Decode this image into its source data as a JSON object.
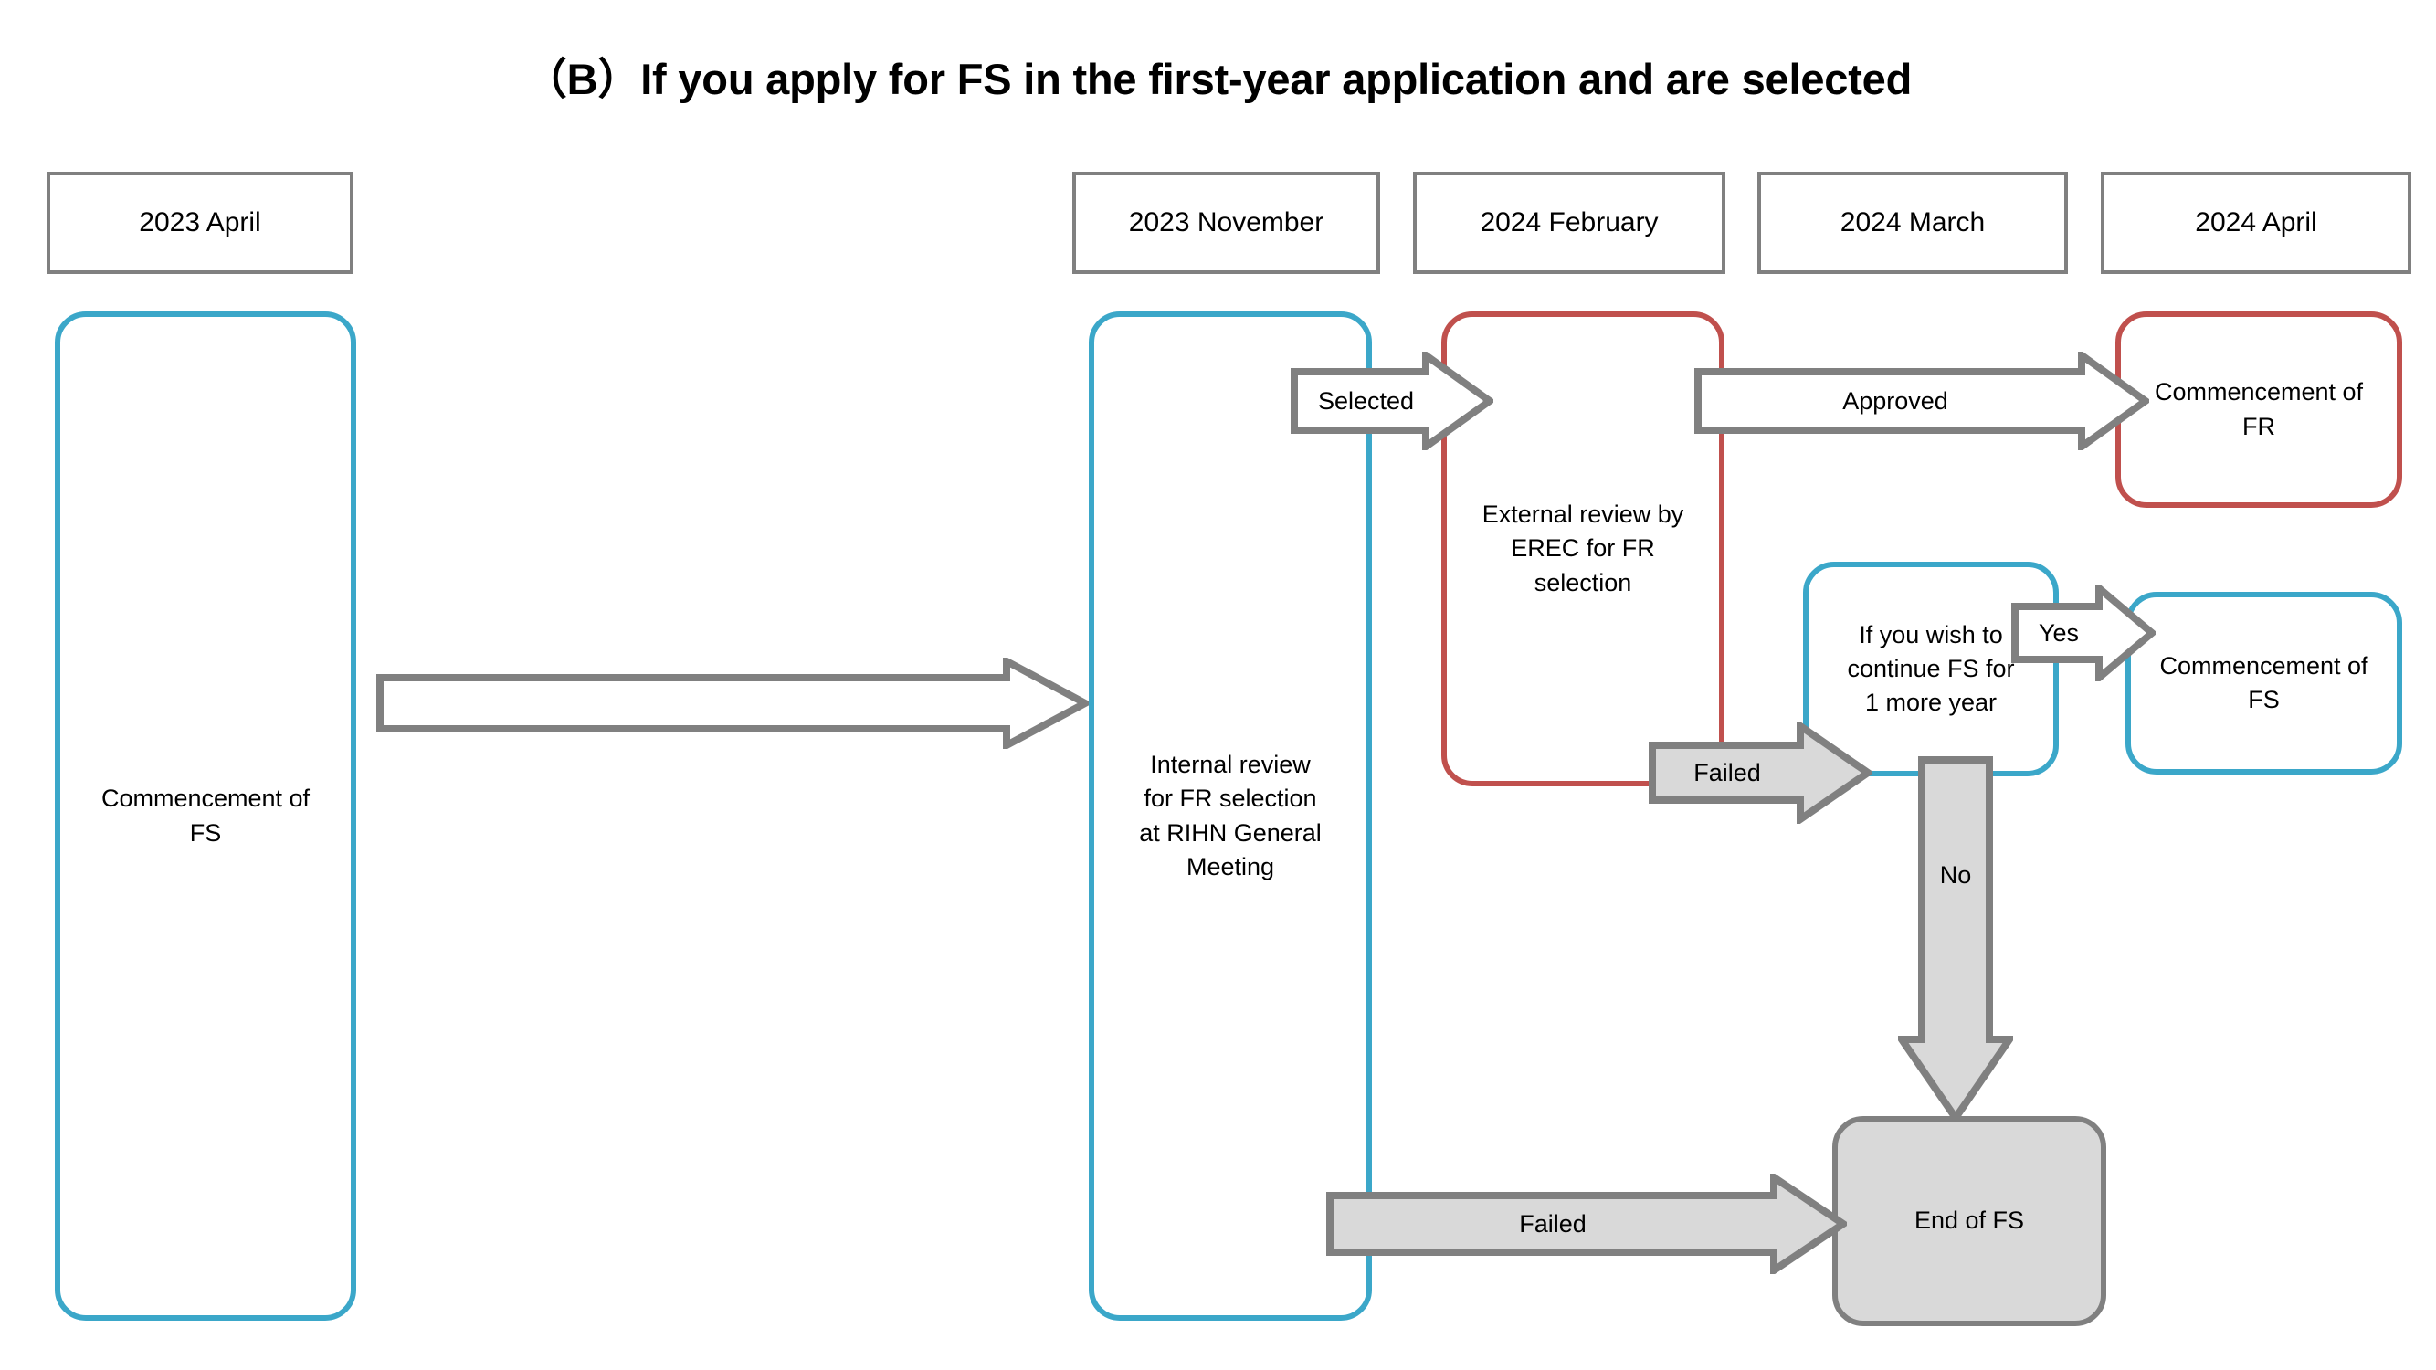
{
  "title": "（B）If you apply for FS in the first-year application and are selected",
  "colors": {
    "blue": "#3BA7C9",
    "red": "#C0504D",
    "gray_outline": "#808080",
    "gray_fill": "#D9D9D9",
    "white": "#FFFFFF",
    "text": "#000000"
  },
  "date_headers": [
    {
      "label": "2023 April"
    },
    {
      "label": "2023 November"
    },
    {
      "label": "2024 February"
    },
    {
      "label": "2024 March"
    },
    {
      "label": "2024 April"
    }
  ],
  "nodes": {
    "commencement_fs_start": "Commencement of\nFS",
    "internal_review": "Internal review\nfor FR selection\nat RIHN General\nMeeting",
    "external_review": "External review by\nEREC for FR\nselection",
    "commencement_fr": "Commencement of\nFR",
    "continue_fs": "If you wish to\ncontinue FS for\n1 more year",
    "commencement_fs_again": "Commencement of\nFS",
    "end_of_fs": "End of FS"
  },
  "arrows": {
    "start_to_november": "",
    "selected": "Selected",
    "approved": "Approved",
    "failed_to_continue": "Failed",
    "yes": "Yes",
    "no": "No",
    "failed_to_end": "Failed"
  }
}
